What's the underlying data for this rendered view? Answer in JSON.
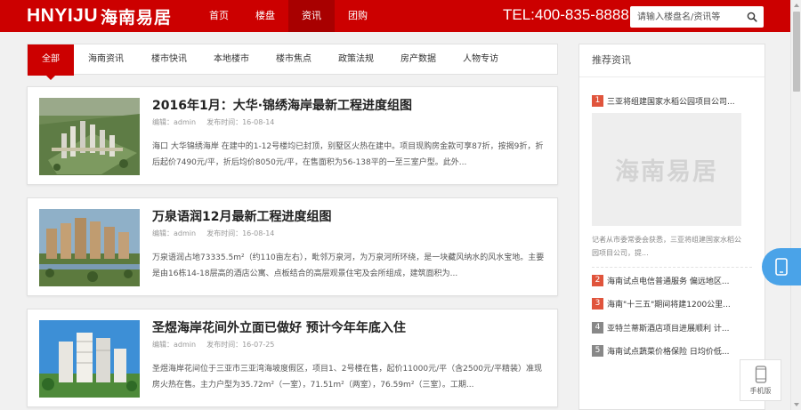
{
  "header": {
    "logo_latin": "HNYIJU",
    "logo_cn": "海南易居",
    "nav": [
      "首页",
      "楼盘",
      "资讯",
      "团购"
    ],
    "active_nav": 2,
    "tel": "TEL:400-835-8888",
    "search_placeholder": "请输入楼盘名/资讯等",
    "brand_color": "#cc0000"
  },
  "tabs": {
    "items": [
      "全部",
      "海南资讯",
      "楼市快讯",
      "本地楼市",
      "楼市焦点",
      "政策法规",
      "房产数据",
      "人物专访"
    ],
    "active": 0
  },
  "articles": [
    {
      "title": "2016年1月：大华·锦绣海岸最新工程进度组图",
      "editor": "编辑：admin",
      "date": "发布时间：16-08-14",
      "desc": "海口 大华锦绣海岸 在建中的1-12号楼均已封顶，别墅区火热在建中。项目现购房金款可享87折，按揭9折，折后起价7490元/平，折后均价8050元/平，在售面积为56-138平的一至三室户型。此外...",
      "thumb": "aerial-render"
    },
    {
      "title": "万泉语润12月最新工程进度组图",
      "editor": "编辑：admin",
      "date": "发布时间：16-08-14",
      "desc": "万泉语润占地73335.5m²（约110亩左右），毗邻万泉河，为万泉河所环绕，是一块藏风纳水的风水宝地。主要是由16栋14-18层高的酒店公寓、点板结合的高层观景住宅及会所组成，建筑面积为...",
      "thumb": "riverside-render"
    },
    {
      "title": "圣煜海岸花间外立面已做好 预计今年年底入住",
      "editor": "编辑：admin",
      "date": "发布时间：16-07-25",
      "desc": "圣煜海岸花间位于三亚市三亚湾海坡度假区，项目1、2号楼在售，起价11000元/平（含2500元/平精装）准现房火热在售。主力户型为35.72m²（一室），71.51m²（两室），76.59m²（三室）。工期...",
      "thumb": "towers-photo"
    }
  ],
  "sidebar": {
    "title": "推荐资讯",
    "top_item": {
      "num": "1",
      "text": "三亚将组建国家水稻公园项目公司..."
    },
    "image_text": "海南易居",
    "summary": "记者从市委常委会获悉，三亚将组建国家水稻公园项目公司，提...",
    "items": [
      {
        "num": "2",
        "text": "海南试点电信普通服务 偏远地区..."
      },
      {
        "num": "3",
        "text": "海南\"十三五\"期间将建1200公里..."
      },
      {
        "num": "4",
        "text": "亚特兰蒂斯酒店项目进展顺利 计..."
      },
      {
        "num": "5",
        "text": "海南试点蔬菜价格保险 日均价低..."
      }
    ],
    "num_colors": [
      "#e0543c",
      "#e0543c",
      "#e0543c",
      "#888888",
      "#888888"
    ]
  },
  "floating": {
    "phone_icon": "phone-icon",
    "mobile_label": "手机版"
  }
}
